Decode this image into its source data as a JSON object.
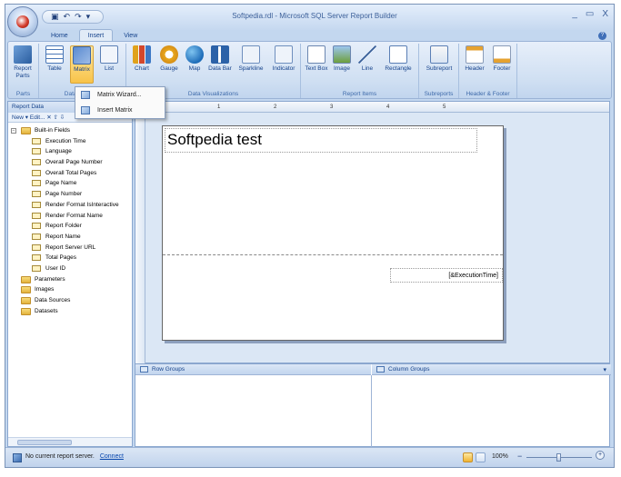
{
  "window": {
    "title": "Softpedia.rdl - Microsoft SQL Server Report Builder",
    "quick_access": [
      "save",
      "undo",
      "redo"
    ],
    "controls": [
      "_",
      "▭",
      "X"
    ]
  },
  "tabs": [
    {
      "label": "Home",
      "active": false
    },
    {
      "label": "Insert",
      "active": true
    },
    {
      "label": "View",
      "active": false
    }
  ],
  "ribbon": {
    "groups": [
      {
        "label": "Parts",
        "buttons": [
          {
            "label": "Report Parts",
            "icon": "parts-icon"
          }
        ]
      },
      {
        "label": "Data Regions",
        "buttons": [
          {
            "label": "Table",
            "icon": "table-icon"
          },
          {
            "label": "Matrix",
            "icon": "matrix-icon",
            "active": true
          },
          {
            "label": "List",
            "icon": "list-icon"
          }
        ]
      },
      {
        "label": "Data Visualizations",
        "buttons": [
          {
            "label": "Chart",
            "icon": "chart-icon"
          },
          {
            "label": "Gauge",
            "icon": "gauge-icon"
          },
          {
            "label": "Map",
            "icon": "map-icon"
          },
          {
            "label": "Data Bar",
            "icon": "databar-icon"
          },
          {
            "label": "Sparkline",
            "icon": "sparkline-icon"
          },
          {
            "label": "Indicator",
            "icon": "indicator-icon"
          }
        ]
      },
      {
        "label": "Report Items",
        "buttons": [
          {
            "label": "Text Box",
            "icon": "textbox-icon"
          },
          {
            "label": "Image",
            "icon": "image-icon"
          },
          {
            "label": "Line",
            "icon": "line-icon"
          },
          {
            "label": "Rectangle",
            "icon": "rectangle-icon"
          }
        ]
      },
      {
        "label": "Subreports",
        "buttons": [
          {
            "label": "Subreport",
            "icon": "subreport-icon"
          }
        ]
      },
      {
        "label": "Header & Footer",
        "buttons": [
          {
            "label": "Header",
            "icon": "header-icon"
          },
          {
            "label": "Footer",
            "icon": "footer-icon"
          }
        ]
      }
    ]
  },
  "matrix_menu": {
    "items": [
      "Matrix Wizard...",
      "Insert Matrix"
    ]
  },
  "report_data": {
    "title": "Report Data",
    "toolbar": "New ▾  Edit...  ✕  ⇧  ⇩",
    "tree": [
      {
        "label": "Built-in Fields",
        "type": "folder",
        "level": 0,
        "expander": "−"
      },
      {
        "label": "Execution Time",
        "type": "field",
        "level": 1
      },
      {
        "label": "Language",
        "type": "field",
        "level": 1
      },
      {
        "label": "Overall Page Number",
        "type": "field",
        "level": 1
      },
      {
        "label": "Overall Total Pages",
        "type": "field",
        "level": 1
      },
      {
        "label": "Page Name",
        "type": "field",
        "level": 1
      },
      {
        "label": "Page Number",
        "type": "field",
        "level": 1
      },
      {
        "label": "Render Format IsInteractive",
        "type": "field",
        "level": 1
      },
      {
        "label": "Render Format Name",
        "type": "field",
        "level": 1
      },
      {
        "label": "Report Folder",
        "type": "field",
        "level": 1
      },
      {
        "label": "Report Name",
        "type": "field",
        "level": 1
      },
      {
        "label": "Report Server URL",
        "type": "field",
        "level": 1
      },
      {
        "label": "Total Pages",
        "type": "field",
        "level": 1
      },
      {
        "label": "User ID",
        "type": "field",
        "level": 1
      },
      {
        "label": "Parameters",
        "type": "folder",
        "level": 0
      },
      {
        "label": "Images",
        "type": "folder",
        "level": 0
      },
      {
        "label": "Data Sources",
        "type": "folder",
        "level": 0
      },
      {
        "label": "Datasets",
        "type": "folder",
        "level": 0
      }
    ]
  },
  "report": {
    "ruler_ticks": [
      "1",
      "2",
      "3",
      "4",
      "5"
    ],
    "title_text": "Softpedia test",
    "exec_time_expr": "[&ExecutionTime]"
  },
  "grouping": {
    "row_groups": "Row Groups",
    "column_groups": "Column Groups"
  },
  "status": {
    "text": "No current report server.",
    "link": "Connect",
    "zoom": "100%",
    "zoom_level": 0.5
  }
}
